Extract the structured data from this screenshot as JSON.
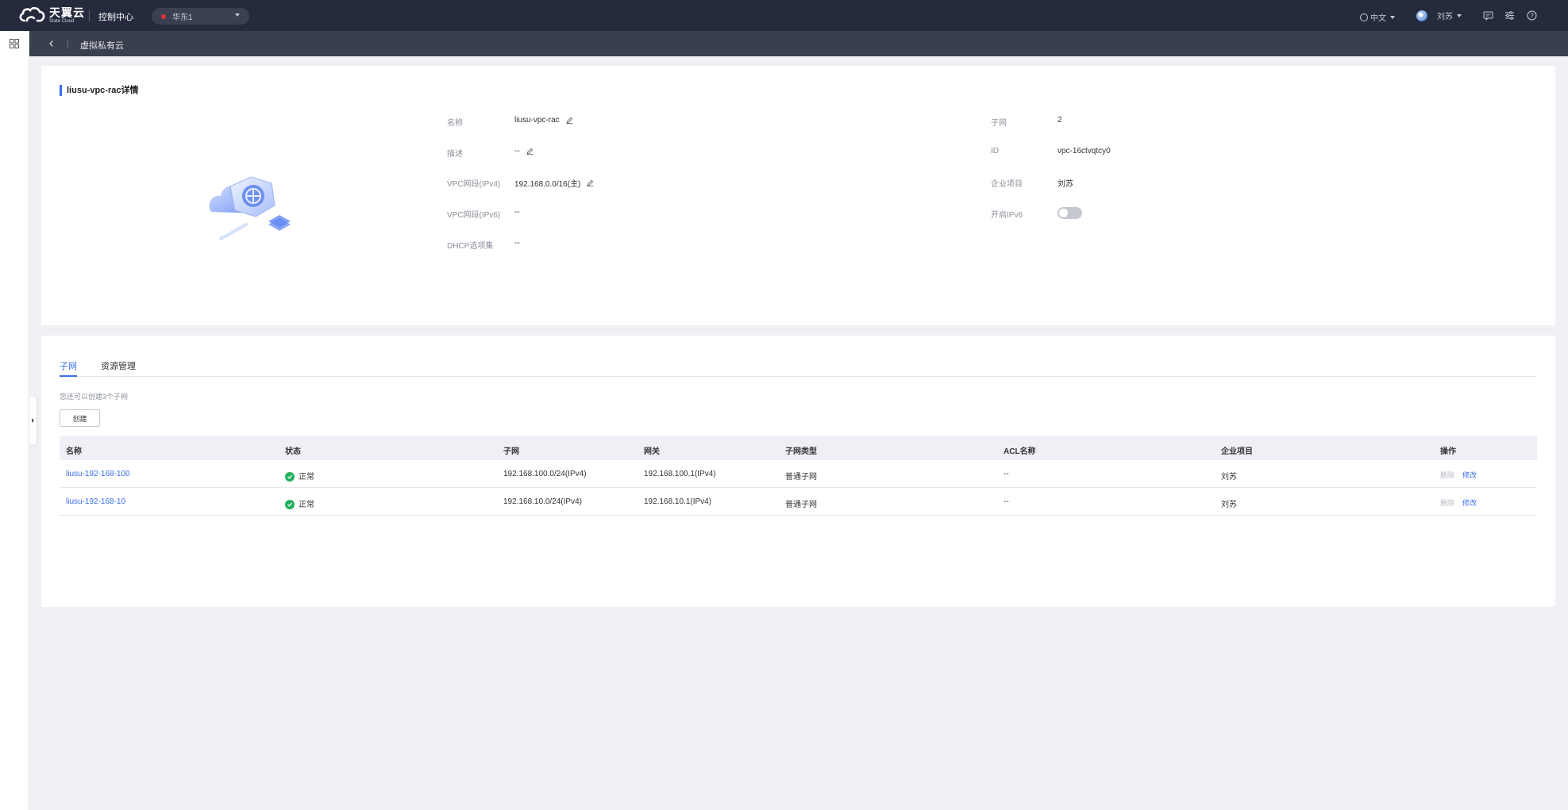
{
  "topbar": {
    "logo_cn": "天翼云",
    "logo_en": "State Cloud",
    "console_title": "控制中心",
    "region": "华东1",
    "language": "中文",
    "user_name": "刘苏"
  },
  "breadcrumb": {
    "title": "虚拟私有云"
  },
  "detail": {
    "title": "liusu-vpc-rac详情",
    "left_fields": [
      {
        "label": "名称",
        "value": "liusu-vpc-rac",
        "editable": true
      },
      {
        "label": "描述",
        "value": "--",
        "editable": true
      },
      {
        "label": "VPC网段(IPv4)",
        "value": "192.168.0.0/16(主)",
        "editable": true
      },
      {
        "label": "VPC网段(IPv6)",
        "value": "--",
        "editable": false
      },
      {
        "label": "DHCP选项集",
        "value": "--",
        "editable": false
      }
    ],
    "right_fields": [
      {
        "label": "子网",
        "value": "2"
      },
      {
        "label": "ID",
        "value": "vpc-16ctvqtcy0"
      },
      {
        "label": "企业项目",
        "value": "刘苏"
      },
      {
        "label": "开启IPv6",
        "value": ""
      }
    ],
    "ipv6_enabled": false
  },
  "tabs": [
    {
      "label": "子网",
      "active": true
    },
    {
      "label": "资源管理",
      "active": false
    }
  ],
  "subnet": {
    "hint": "您还可以创建3个子网",
    "create_label": "创建",
    "columns": [
      "名称",
      "状态",
      "子网",
      "网关",
      "子网类型",
      "ACL名称",
      "企业项目",
      "操作"
    ],
    "rows": [
      {
        "name": "liusu-192-168-100",
        "status": "正常",
        "subnet": "192.168.100.0/24(IPv4)",
        "gateway": "192.168.100.1(IPv4)",
        "type": "普通子网",
        "acl": "--",
        "project": "刘苏",
        "op_delete": "删除",
        "op_edit": "修改"
      },
      {
        "name": "liusu-192-168-10",
        "status": "正常",
        "subnet": "192.168.10.0/24(IPv4)",
        "gateway": "192.168.10.1(IPv4)",
        "type": "普通子网",
        "acl": "--",
        "project": "刘苏",
        "op_delete": "删除",
        "op_edit": "修改"
      }
    ]
  },
  "colors": {
    "topbar": "#252a3d",
    "accent": "#3a6ee8",
    "status_ok": "#22b05d"
  }
}
